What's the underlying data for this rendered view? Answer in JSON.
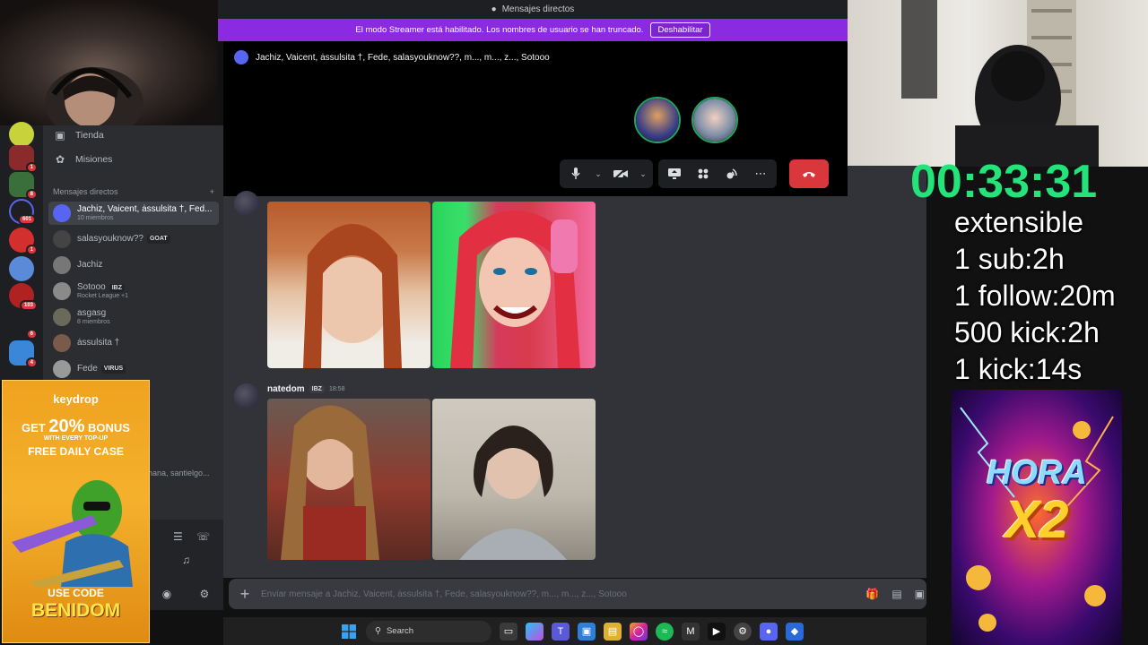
{
  "titlebar": {
    "title": "Mensajes directos"
  },
  "streamer_bar": {
    "message": "El modo Streamer está habilitado. Los nombres de usuario se han truncado.",
    "button": "Deshabilitar"
  },
  "call": {
    "title": "Jachiz, Vaicent, ȧssulsita †, Fede, salasyouknow??, m..., m..., z..., Sotooo"
  },
  "sidebar": {
    "nav": [
      {
        "label": "Tienda",
        "icon": "shop-icon"
      },
      {
        "label": "Misiones",
        "icon": "quests-icon"
      }
    ],
    "dm_header": "Mensajes directos",
    "dm_add": "+",
    "dms": [
      {
        "name": "Jachiz, Vaicent, ȧssulsita †, Fed...",
        "sub": "10 miembros",
        "tag": ""
      },
      {
        "name": "salasyouknow??",
        "sub": "",
        "tag": "GOAT"
      },
      {
        "name": "Jachiz",
        "sub": "",
        "tag": ""
      },
      {
        "name": "Sotooo",
        "sub": "Rocket League +1",
        "tag": "IBZ"
      },
      {
        "name": "asgasg",
        "sub": "8 miembros",
        "tag": ""
      },
      {
        "name": "ȧssulsita †",
        "sub": "",
        "tag": ""
      },
      {
        "name": "Fede",
        "sub": "",
        "tag": "VIRUS"
      }
    ],
    "partial_dm": "hana, santielgo...",
    "server_badges": [
      "1",
      "8",
      "601",
      "1",
      "103",
      "6",
      "4"
    ]
  },
  "messages": [
    {
      "author": "natedom",
      "tag": "IBZ",
      "time": "18:58"
    }
  ],
  "composer": {
    "placeholder": "Enviar mensaje a Jachiz, Vaicent, ȧssulsita †, Fede, salasyouknow??, m..., m..., z..., Sotooo"
  },
  "overlay": {
    "timer": "00:33:31",
    "goals": [
      "extensible",
      "1 sub:2h",
      "1 follow:20m",
      "500 kick:2h",
      "1 kick:14s"
    ]
  },
  "promo": {
    "brand": "keydrop",
    "get": "GET",
    "percent": "20%",
    "bonus": "BONUS",
    "with": "WITH EVERY TOP-UP",
    "free": "FREE DAILY CASE",
    "use_code": "USE CODE",
    "code": "BENIDOM"
  },
  "hora": {
    "line1": "HORA",
    "line2": "X2"
  },
  "taskbar": {
    "search": "Search"
  },
  "colors": {
    "streamer_purple": "#8a2be2",
    "hangup_red": "#da373c",
    "timer_green": "#24e37a",
    "online_green": "#23a55a"
  }
}
